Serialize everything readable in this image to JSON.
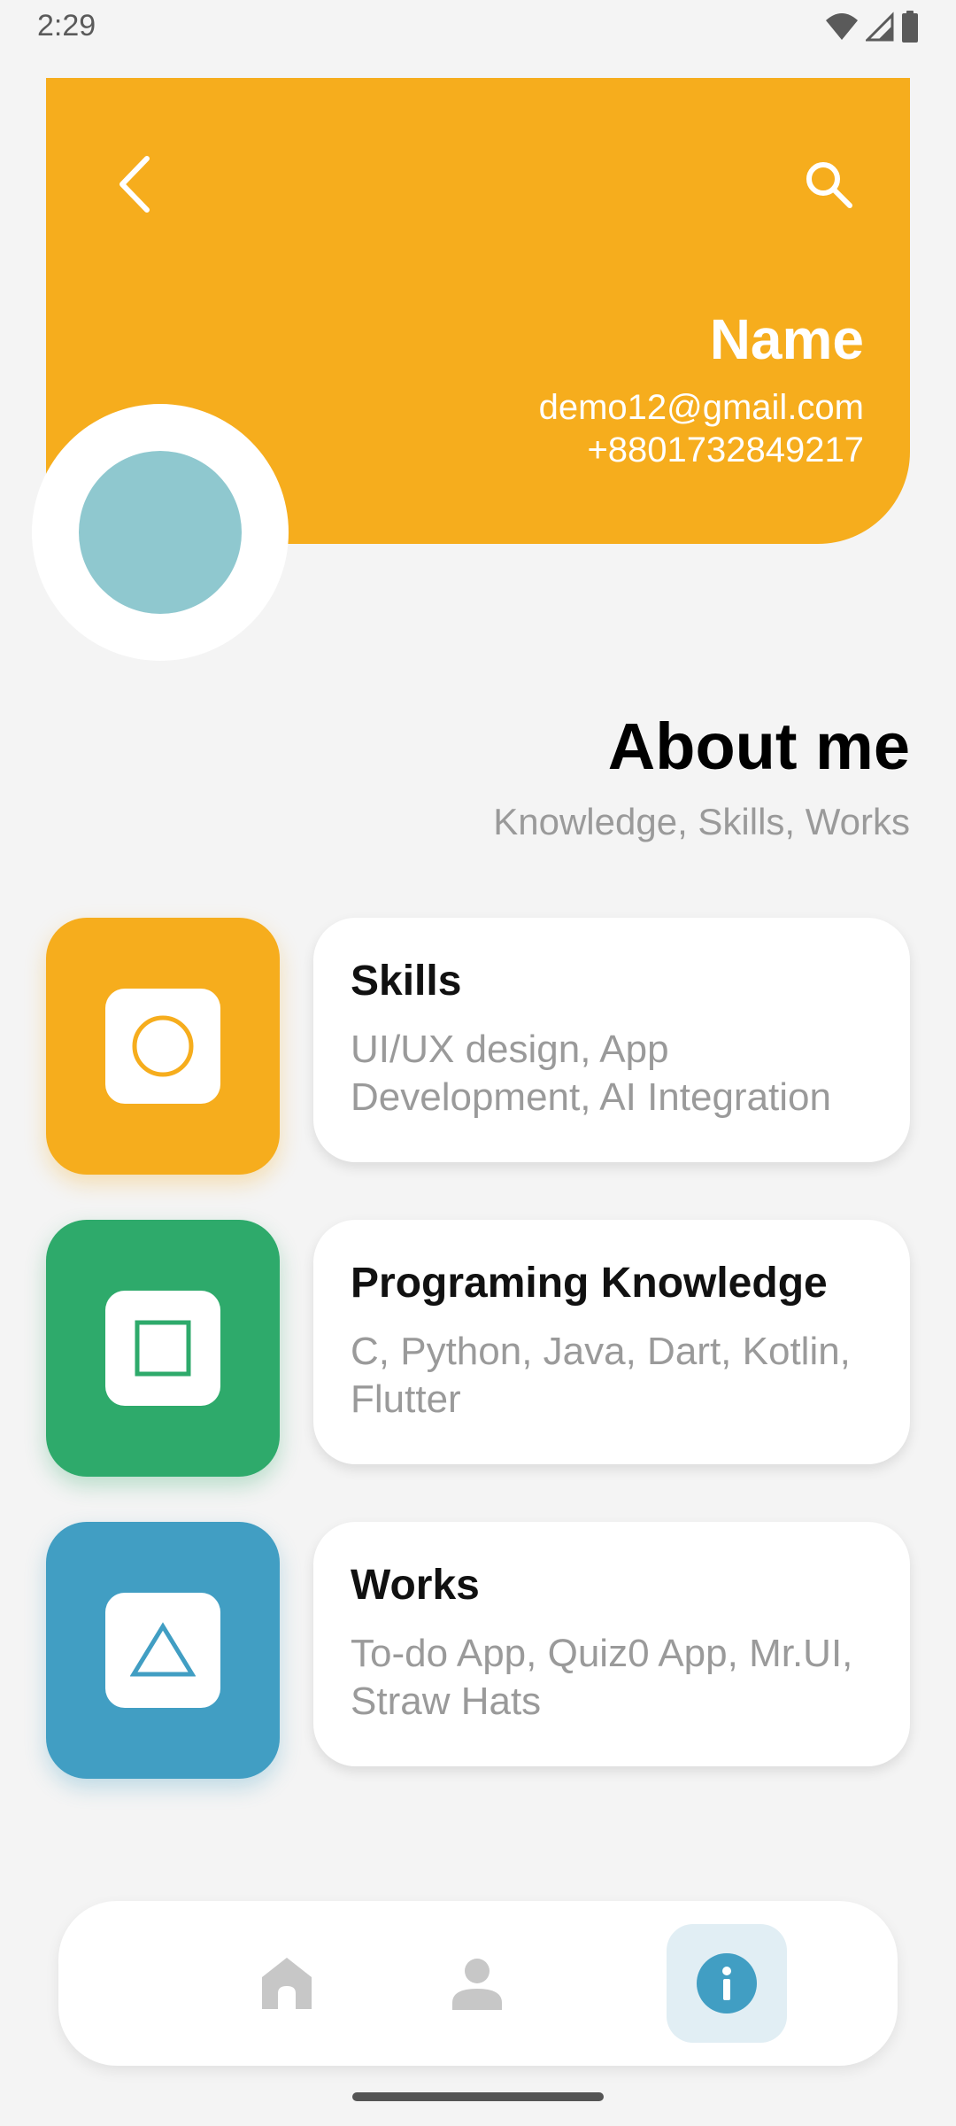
{
  "status_bar": {
    "time": "2:29",
    "icons": [
      "wifi-icon",
      "cellular-signal-icon",
      "battery-icon"
    ]
  },
  "header": {
    "background_color": "#f6ad1d",
    "back_icon": "chevron-left-icon",
    "search_icon": "search-icon",
    "name": "Name",
    "email": "demo12@gmail.com",
    "phone": "+8801732849217"
  },
  "avatar": {
    "color": "#8fc8cf"
  },
  "about": {
    "title": "About me",
    "subtitle": "Knowledge, Skills, Works"
  },
  "cards": [
    {
      "title": "Skills",
      "description": "UI/UX design, App Development, AI Integration",
      "color": "#f6ad1d",
      "icon": "circle-icon"
    },
    {
      "title": "Programing Knowledge",
      "description": "C, Python, Java, Dart, Kotlin, Flutter",
      "color": "#2eaa6b",
      "icon": "square-icon"
    },
    {
      "title": "Works",
      "description": "To-do App, Quiz0 App, Mr.UI, Straw Hats",
      "color": "#419ec3",
      "icon": "triangle-icon"
    }
  ],
  "bottom_nav": {
    "items": [
      {
        "icon": "home-icon",
        "active": false
      },
      {
        "icon": "person-icon",
        "active": false
      },
      {
        "icon": "info-icon",
        "active": true
      }
    ],
    "active_color": "#419ec3",
    "inactive_color": "#c7c7c7"
  }
}
